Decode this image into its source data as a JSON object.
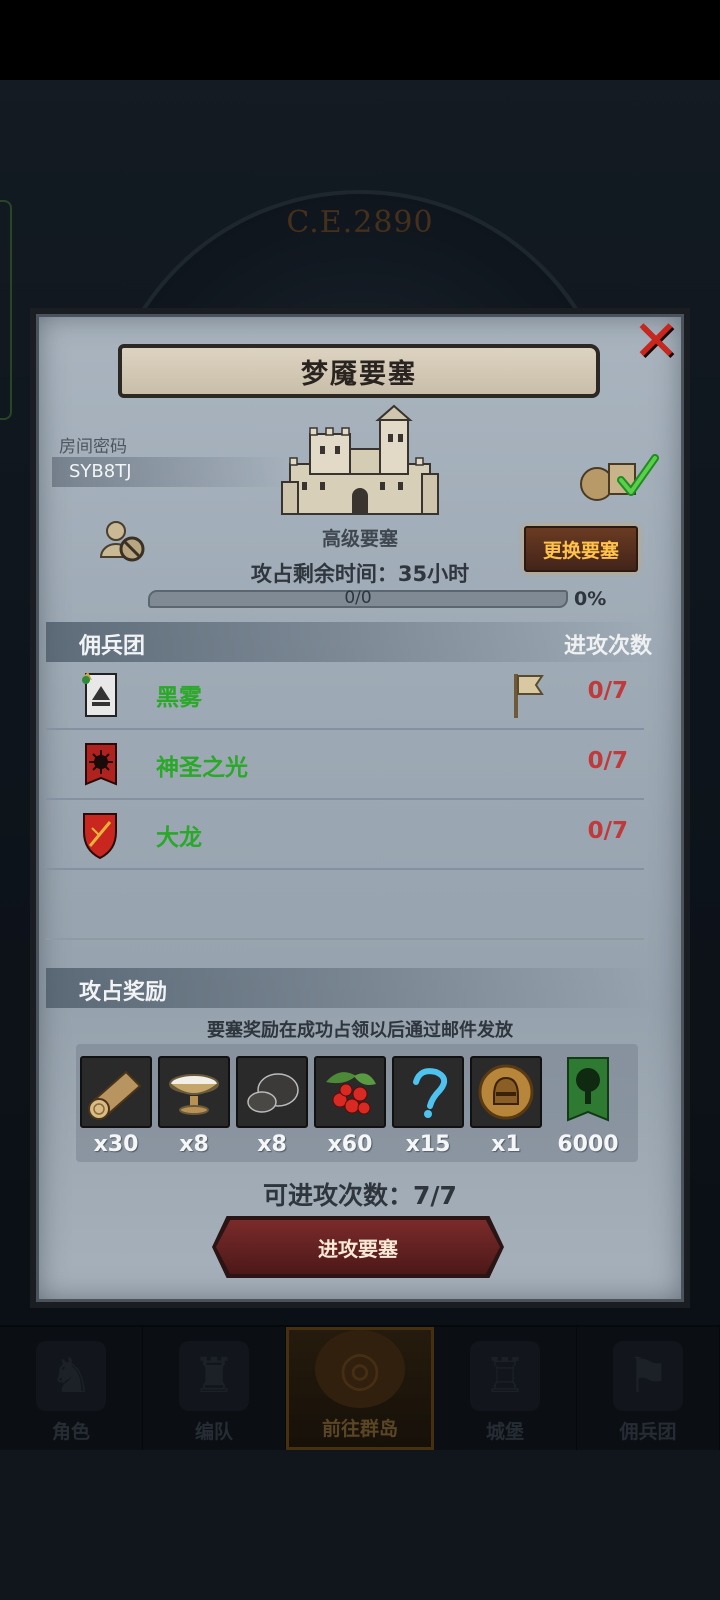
{
  "background": {
    "era_text": "C.E.2890"
  },
  "bottom_nav": [
    {
      "label": "角色",
      "icon": "knight-icon",
      "active": false
    },
    {
      "label": "编队",
      "icon": "formation-icon",
      "active": false
    },
    {
      "label": "前往群岛",
      "icon": "globe-icon",
      "active": true
    },
    {
      "label": "城堡",
      "icon": "castle-icon",
      "active": false
    },
    {
      "label": "佣兵团",
      "icon": "mercenary-icon",
      "active": false
    }
  ],
  "dialog": {
    "title": "梦魇要塞",
    "room_code_label": "房间密码",
    "room_code": "SYB8TJ",
    "fortress_type": "高级要塞",
    "time_remaining": "攻占剩余时间：35小时",
    "change_button": "更换要塞",
    "progress": {
      "text": "0/0",
      "percent_label": "0%",
      "fraction": 0
    },
    "mercenary_header": "佣兵团",
    "attack_count_header": "进攻次数",
    "mercenaries": [
      {
        "name": "黑雾",
        "count": "0/7",
        "emblem": "black-fog-banner-icon",
        "has_flag": true
      },
      {
        "name": "神圣之光",
        "count": "0/7",
        "emblem": "holy-light-banner-icon",
        "has_flag": false
      },
      {
        "name": "大龙",
        "count": "0/7",
        "emblem": "dragon-shield-icon",
        "has_flag": false
      }
    ],
    "rewards_header": "攻占奖励",
    "reward_note": "要塞奖励在成功占领以后通过邮件发放",
    "rewards": [
      {
        "icon": "wood-log-icon",
        "qty": "x30"
      },
      {
        "icon": "salt-bowl-icon",
        "qty": "x8"
      },
      {
        "icon": "stone-ore-icon",
        "qty": "x8"
      },
      {
        "icon": "berries-icon",
        "qty": "x60"
      },
      {
        "icon": "mystery-swirl-icon",
        "qty": "x15"
      },
      {
        "icon": "helmet-coin-icon",
        "qty": "x1"
      },
      {
        "icon": "tree-banner-icon",
        "qty": "6000"
      }
    ],
    "available_attacks": "可进攻次数：7/7",
    "attack_button": "进攻要塞"
  },
  "colors": {
    "merc_name": "#2aa828",
    "attack_count": "#c0393b",
    "change_button_text": "#ffc24a",
    "close_x": "#c9261e"
  }
}
